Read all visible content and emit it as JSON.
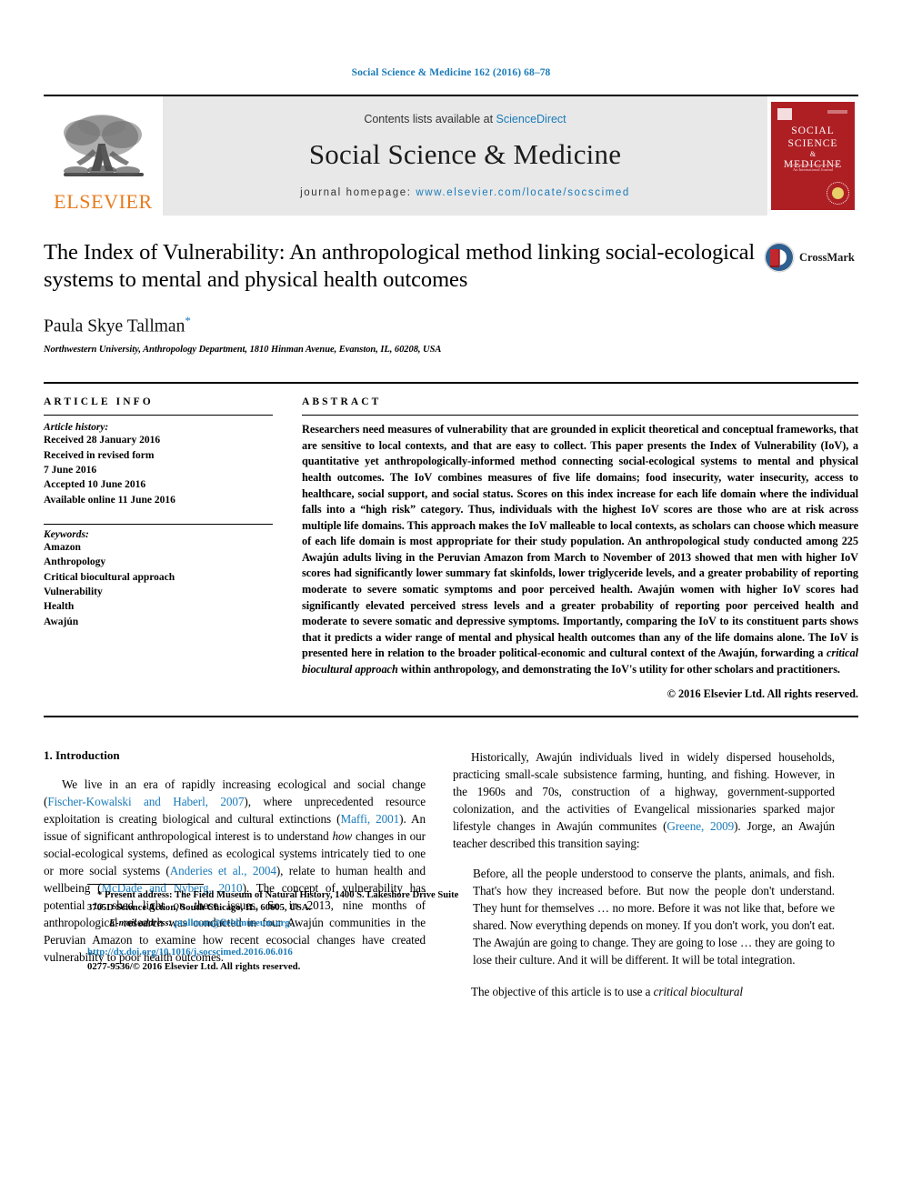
{
  "running_head": "Social Science & Medicine 162 (2016) 68–78",
  "masthead": {
    "publisher_wordmark": "ELSEVIER",
    "contents_prefix": "Contents lists available at ",
    "contents_link": "ScienceDirect",
    "journal_name": "Social Science & Medicine",
    "homepage_prefix": "journal homepage: ",
    "homepage_url": "www.elsevier.com/locate/socscimed",
    "cover": {
      "line1": "SOCIAL",
      "line2": "SCIENCE",
      "amp": "&",
      "line3": "MEDICINE",
      "subtitle": "An International Journal"
    }
  },
  "article": {
    "title": "The Index of Vulnerability: An anthropological method linking social-ecological systems to mental and physical health outcomes",
    "crossmark_label": "CrossMark",
    "author": "Paula Skye Tallman",
    "author_marker": "*",
    "affiliation": "Northwestern University, Anthropology Department, 1810 Hinman Avenue, Evanston, IL, 60208, USA"
  },
  "info": {
    "heading": "ARTICLE INFO",
    "history_label": "Article history:",
    "history": [
      "Received 28 January 2016",
      "Received in revised form",
      "7 June 2016",
      "Accepted 10 June 2016",
      "Available online 11 June 2016"
    ],
    "keywords_label": "Keywords:",
    "keywords": [
      "Amazon",
      "Anthropology",
      "Critical biocultural approach",
      "Vulnerability",
      "Health",
      "Awajún"
    ]
  },
  "abstract": {
    "heading": "ABSTRACT",
    "part1": "Researchers need measures of vulnerability that are grounded in explicit theoretical and conceptual frameworks, that are sensitive to local contexts, and that are easy to collect. This paper presents the Index of Vulnerability (IoV), a quantitative yet anthropologically-informed method connecting social-ecological systems to mental and physical health outcomes. The IoV combines measures of five life domains; food insecurity, water insecurity, access to healthcare, social support, and social status. Scores on this index increase for each life domain where the individual falls into a “high risk” category. Thus, individuals with the highest IoV scores are those who are at risk across multiple life domains. This approach makes the IoV malleable to local contexts, as scholars can choose which measure of each life domain is most appropriate for their study population. An anthropological study conducted among 225 Awajún adults living in the Peruvian Amazon from March to November of 2013 showed that men with higher IoV scores had significantly lower summary fat skinfolds, lower triglyceride levels, and a greater probability of reporting moderate to severe somatic symptoms and poor perceived health. Awajún women with higher IoV scores had significantly elevated perceived stress levels and a greater probability of reporting poor perceived health and moderate to severe somatic and depressive symptoms. Importantly, comparing the IoV to its constituent parts shows that it predicts a wider range of mental and physical health outcomes than any of the life domains alone. The IoV is presented here in relation to the broader political-economic and cultural context of the Awajún, forwarding a ",
    "italic_phrase": "critical biocultural approach",
    "part2": " within anthropology, and demonstrating the IoV's utility for other scholars and practitioners.",
    "copyright": "© 2016 Elsevier Ltd. All rights reserved."
  },
  "body": {
    "section_heading": "1. Introduction",
    "left_para_1a": "We live in an era of rapidly increasing ecological and social change (",
    "left_cite_1": "Fischer-Kowalski and Haberl, 2007",
    "left_para_1b": "), where unprecedented resource exploitation is creating biological and cultural extinctions (",
    "left_cite_2": "Maffi, 2001",
    "left_para_1c": "). An issue of significant anthropological interest is to understand ",
    "left_italic_1": "how",
    "left_para_1d": " changes in our social-ecological systems, defined as ecological systems intricately tied to one or more social systems (",
    "left_cite_3": "Anderies et al., 2004",
    "left_para_1e": "), relate to human health and wellbeing (",
    "left_cite_4": "McDade and Nyberg, 2010",
    "left_para_1f": "). The concept of vulnerability has potential to shed light on these issues. So in 2013, nine months of anthropological research was conducted in four Awajún communities in the Peruvian Amazon to examine how recent ecosocial changes have created vulnerability to poor health outcomes.",
    "right_para_1a": "Historically, Awajún individuals lived in widely dispersed households, practicing small-scale subsistence farming, hunting, and fishing. However, in the 1960s and 70s, construction of a highway, government-supported colonization, and the activities of Evangelical missionaries sparked major lifestyle changes in Awajún communites (",
    "right_cite_1": "Greene, 2009",
    "right_para_1b": "). Jorge, an Awajún teacher described this transition saying:",
    "quote": "Before, all the people understood to conserve the plants, animals, and fish. That's how they increased before. But now the people don't understand. They hunt for themselves … no more. Before it was not like that, before we shared. Now everything depends on money. If you don't work, you don't eat. The Awajún are going to change. They are going to lose … they are going to lose their culture. And it will be different. It will be total integration.",
    "right_para_2a": "The objective of this article is to use a ",
    "right_italic_2": "critical biocultural"
  },
  "footnote": {
    "marker": "*",
    "text": " Present address: The Field Museum of Natural History, 1400 S. Lakeshore Drive Suite 3705D Science Action, South Chicago, IL, 60605, USA.",
    "email_label": "E-mail address:",
    "email": "ptallman@fieldmuseum.org",
    "doi": "http://dx.doi.org/10.1016/j.socscimed.2016.06.016",
    "issn_line": "0277-9536/© 2016 Elsevier Ltd. All rights reserved."
  },
  "colors": {
    "link": "#1a7bb9",
    "elsevier_orange": "#E87B1E",
    "cover_red": "#AE1F24"
  }
}
